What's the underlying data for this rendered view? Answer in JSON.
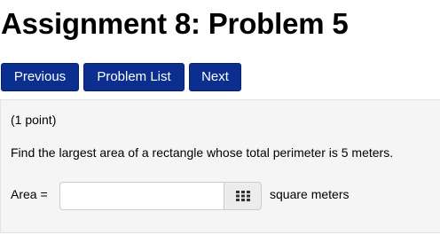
{
  "page": {
    "title": "Assignment 8: Problem 5"
  },
  "nav": {
    "previous_label": "Previous",
    "problem_list_label": "Problem List",
    "next_label": "Next"
  },
  "problem": {
    "points": "(1 point)",
    "question": "Find the largest area of a rectangle whose total perimeter is 5 meters.",
    "answer_label": "Area =",
    "answer_value": "",
    "units": "square meters",
    "palette_icon": "keypad-grid-icon"
  },
  "colors": {
    "nav_button_bg": "#0b2f8f",
    "panel_bg": "#f5f5f5"
  }
}
